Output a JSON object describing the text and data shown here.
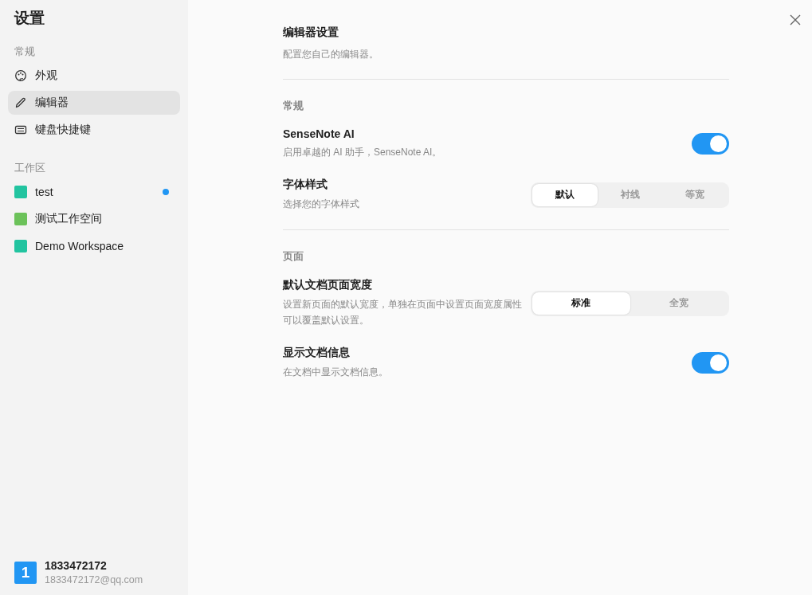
{
  "sidebar": {
    "title": "设置",
    "groups": [
      {
        "label": "常规",
        "kind": "nav",
        "items": [
          {
            "label": "外观",
            "selected": false
          },
          {
            "label": "编辑器",
            "selected": true
          },
          {
            "label": "键盘快捷键",
            "selected": false
          }
        ]
      },
      {
        "label": "工作区",
        "kind": "workspace",
        "items": [
          {
            "label": "test",
            "color": "#22c4a0",
            "unread": true,
            "selected": false
          },
          {
            "label": "测试工作空间",
            "color": "#6cc25a",
            "unread": false,
            "selected": false
          },
          {
            "label": "Demo Workspace",
            "color": "#22c4a0",
            "unread": false,
            "selected": false
          }
        ]
      }
    ],
    "user": {
      "avatar": "1",
      "name": "1833472172",
      "email": "1833472172@qq.com"
    }
  },
  "main": {
    "title": "编辑器设置",
    "subtitle": "配置您自己的编辑器。",
    "sections": [
      {
        "label": "常规",
        "rows": [
          {
            "kind": "toggle",
            "title": "SenseNote AI",
            "description": "启用卓越的 AI 助手，SenseNote AI。",
            "on": true
          },
          {
            "kind": "segmented",
            "title": "字体样式",
            "description": "选择您的字体样式",
            "options": [
              {
                "label": "默认",
                "selected": true
              },
              {
                "label": "衬线",
                "selected": false
              },
              {
                "label": "等宽",
                "selected": false
              }
            ]
          }
        ]
      },
      {
        "label": "页面",
        "rows": [
          {
            "kind": "segmented",
            "title": "默认文档页面宽度",
            "description": "设置新页面的默认宽度，单独在页面中设置页面宽度属性可以覆盖默认设置。",
            "options": [
              {
                "label": "标准",
                "selected": true
              },
              {
                "label": "全宽",
                "selected": false
              }
            ]
          },
          {
            "kind": "toggle",
            "title": "显示文档信息",
            "description": "在文档中显示文档信息。",
            "on": true
          }
        ]
      }
    ]
  }
}
